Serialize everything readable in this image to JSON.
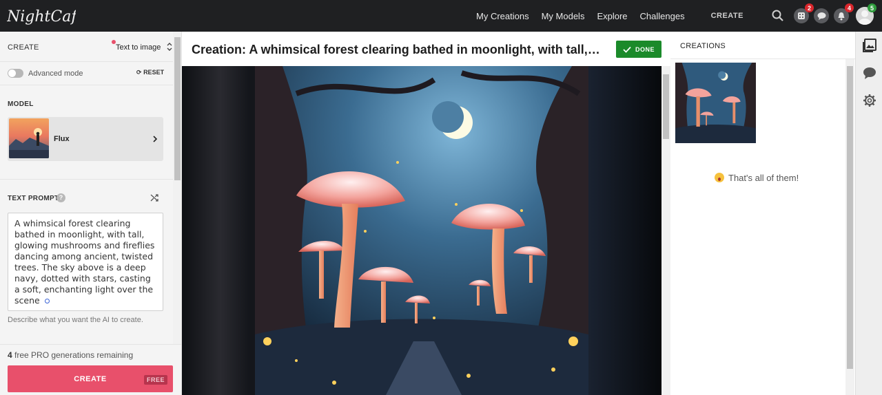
{
  "app": {
    "logo_text": "NightCafe"
  },
  "nav": {
    "links": [
      "My Creations",
      "My Models",
      "Explore",
      "Challenges"
    ],
    "create_label": "CREATE",
    "badges": {
      "dice": "2",
      "notifications": "4",
      "avatar": "5"
    }
  },
  "left_panel": {
    "create_label": "CREATE",
    "mode_select": "Text to image",
    "advanced_mode_label": "Advanced mode",
    "reset_label": "RESET",
    "model_section": "MODEL",
    "model_name": "Flux",
    "text_prompt_label": "TEXT PROMPT",
    "prompt_text": "A whimsical forest clearing bathed in moonlight, with tall, glowing mushrooms and fireflies dancing among ancient, twisted trees. The sky above is a deep navy, dotted with stars, casting a soft, enchanting light over the scene",
    "prompt_hint": "Describe what you want the AI to create.",
    "remaining_count": "4",
    "remaining_text": "free PRO generations remaining",
    "create_button": "CREATE",
    "free_tag": "FREE"
  },
  "center": {
    "title": "Creation: A whimsical forest clearing bathed in moonlight, with tall, glowing mushrooms and fireflies dancing among ancient, twisted trees",
    "title_display": "Creation: A whimsical forest clearing bathed in moonlight, with tall,…",
    "done_label": "DONE"
  },
  "right_panel": {
    "creations_label": "CREATIONS",
    "end_message": "That's all of them!"
  },
  "colors": {
    "accent": "#e8506b",
    "done_green": "#1b8a2a",
    "topbar": "#1f2022"
  }
}
